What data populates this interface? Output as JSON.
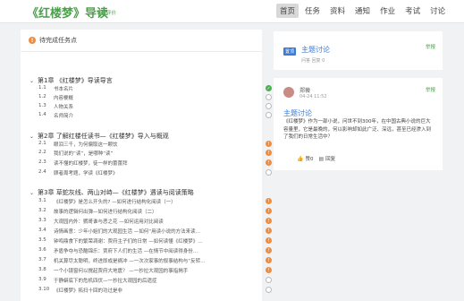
{
  "header": {
    "title": "《红楼梦》导读",
    "subtitle": "课程评价",
    "nav": [
      "首页",
      "任务",
      "资料",
      "通知",
      "作业",
      "考试",
      "讨论"
    ]
  },
  "tasks": {
    "panel_title": "待完成任务点",
    "chapters": [
      {
        "title": "第1章 《红楼梦》导读导言",
        "lessons": [
          {
            "num": "1.1",
            "text": "书本名片",
            "status": "done"
          },
          {
            "num": "1.2",
            "text": "内容梗概",
            "status": "empty"
          },
          {
            "num": "1.3",
            "text": "人物关系",
            "status": "empty"
          },
          {
            "num": "1.4",
            "text": "名师简介",
            "status": "empty"
          }
        ]
      },
      {
        "title": "第2章 了解红楼任读书—《红楼梦》导入与概观",
        "lessons": [
          {
            "num": "2.1",
            "text": "眼泪三千，为何偏取这一颗饮",
            "status": "pending"
          },
          {
            "num": "2.2",
            "text": "我们说的“读”，是哪种“读”",
            "status": "pending"
          },
          {
            "num": "2.3",
            "text": "读不懂的红楼梦，徒一样的蕾蕾拜",
            "status": "pending"
          },
          {
            "num": "2.4",
            "text": "顾者周考题，学读《红楼梦》",
            "status": "empty"
          }
        ]
      },
      {
        "title": "第3章 草蛇灰线、两山对峙—《红楼梦》遇读与阅读策略",
        "lessons": [
          {
            "num": "3.1",
            "text": "《红楼梦》是怎么开头的? —如何进行结构化阅读（一）",
            "status": "pending"
          },
          {
            "num": "3.2",
            "text": "故事的逻辑何出弹—如何进行结构化阅读（二）",
            "status": "pending"
          },
          {
            "num": "3.3",
            "text": "大观园内外：鹦哥谁与恶之花 —如何运用对比阅读",
            "status": "pending"
          },
          {
            "num": "3.4",
            "text": "诗情画意：少年小姐们的大观园生活 —如何“用读小说的方法来读…",
            "status": "pending"
          },
          {
            "num": "3.5",
            "text": "钟鸣鼎食下的繁荣凋谢：贾府主子们的日常 —如何读懂《红楼梦》…",
            "status": "pending"
          },
          {
            "num": "3.6",
            "text": "矛盾争夺与恐酷锦乐：贾府下人们的生活 —在情节中阅读得身份…",
            "status": "pending"
          },
          {
            "num": "3.7",
            "text": "机关算尽太聪明，终进即成是祸冲 —一次次家事的叙事结构与“反转…",
            "status": "pending"
          },
          {
            "num": "3.8",
            "text": "一个小镜窗何以搅起贾府大地震？ —一抄拉大观园的事指揭手",
            "status": "pending"
          },
          {
            "num": "3.9",
            "text": "于静僻底下的危机四伏—一抄拉大观园的后遗症",
            "status": "empty"
          },
          {
            "num": "3.10",
            "text": "《红楼梦》拓扫十回的功过是非",
            "status": "empty"
          }
        ]
      }
    ]
  },
  "topic_card": {
    "tag": "置顶",
    "title": "主题讨论",
    "meta": "问答   回复 0",
    "action": "举报"
  },
  "post_card": {
    "author": "郑薇",
    "time": "04-24 11:52",
    "title": "主题讨论",
    "body": "《红楼梦》作为一部小说，问世不到300年，在中国古典小说的巨大容量里，它是最晚的，何以影响却如此广泛、深远，甚至已经渗入到了我们的日常生活中？",
    "like": "赞0",
    "reply": "回复",
    "action": "举报"
  }
}
